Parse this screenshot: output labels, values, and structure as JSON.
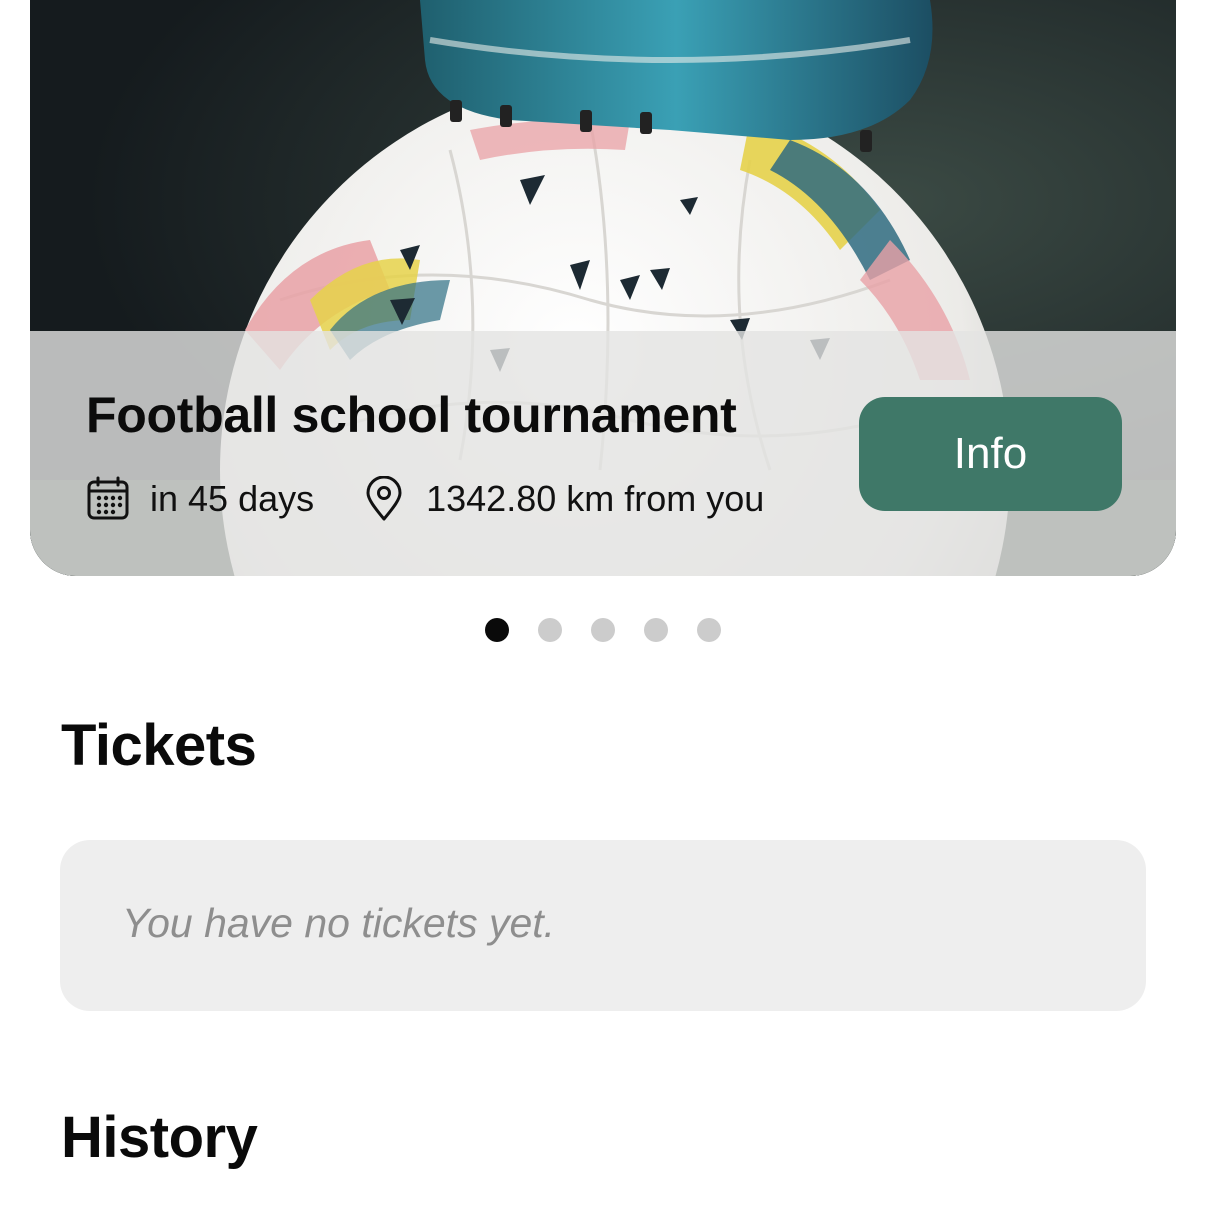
{
  "event": {
    "title": "Football school tournament",
    "date_text": "in 45 days",
    "distance_text": "1342.80 km from you",
    "info_label": "Info",
    "calendar_icon": "calendar-icon",
    "location_icon": "location-pin-icon"
  },
  "pager": {
    "count": 5,
    "active_index": 0
  },
  "tickets": {
    "title": "Tickets",
    "empty_text": "You have no tickets yet."
  },
  "history": {
    "title": "History"
  },
  "colors": {
    "accent": "#3f7868",
    "overlay": "#e4e4e2",
    "empty_box": "#eeeeee",
    "dot_active": "#0a0a0a",
    "dot_inactive": "#cccccc"
  }
}
